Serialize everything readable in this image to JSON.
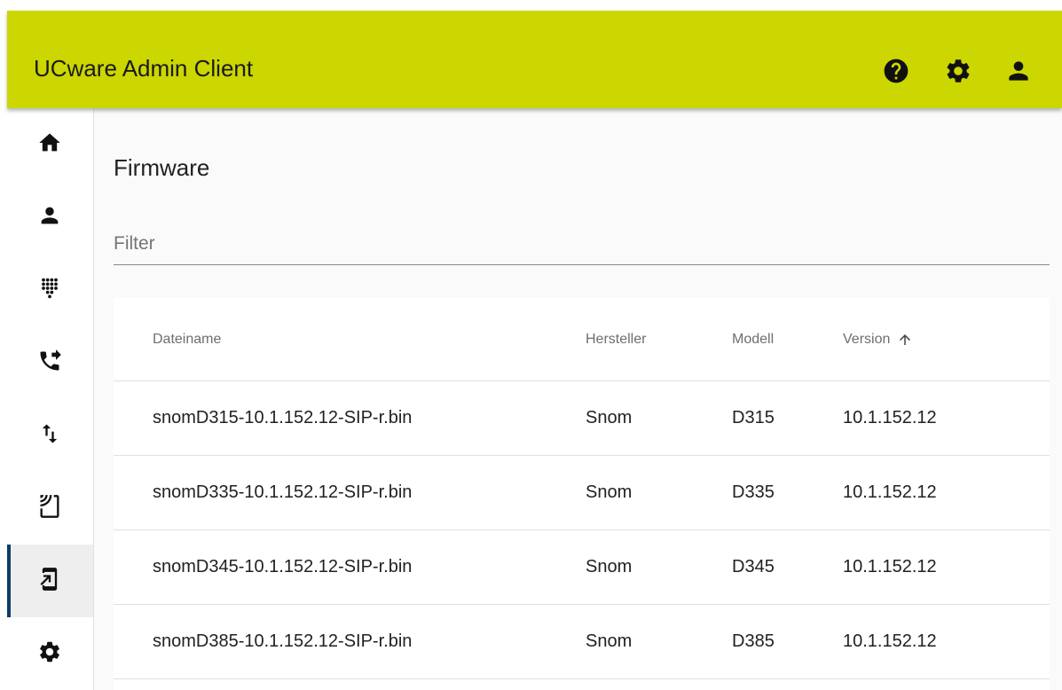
{
  "app": {
    "title": "UCware Admin Client",
    "accent_color": "#ccd600",
    "active_indicator_color": "#0b3d66"
  },
  "toolbar_icons": [
    "help-icon",
    "settings-icon",
    "account-icon"
  ],
  "sidebar": {
    "items": [
      {
        "icon": "home-icon",
        "active": false
      },
      {
        "icon": "user-icon",
        "active": false
      },
      {
        "icon": "dialpad-icon",
        "active": false
      },
      {
        "icon": "phone-forward-icon",
        "active": false
      },
      {
        "icon": "import-export-icon",
        "active": false
      },
      {
        "icon": "cast-icon",
        "active": false
      },
      {
        "icon": "device-settings-icon",
        "active": true
      },
      {
        "icon": "settings-icon",
        "active": false
      }
    ]
  },
  "page": {
    "title": "Firmware",
    "filter_placeholder": "Filter",
    "filter_value": ""
  },
  "table": {
    "columns": [
      "Dateiname",
      "Hersteller",
      "Modell",
      "Version"
    ],
    "sort": {
      "column": "Version",
      "direction": "ascending"
    },
    "rows": [
      {
        "filename": "snomD315-10.1.152.12-SIP-r.bin",
        "vendor": "Snom",
        "model": "D315",
        "version": "10.1.152.12"
      },
      {
        "filename": "snomD335-10.1.152.12-SIP-r.bin",
        "vendor": "Snom",
        "model": "D335",
        "version": "10.1.152.12"
      },
      {
        "filename": "snomD345-10.1.152.12-SIP-r.bin",
        "vendor": "Snom",
        "model": "D345",
        "version": "10.1.152.12"
      },
      {
        "filename": "snomD385-10.1.152.12-SIP-r.bin",
        "vendor": "Snom",
        "model": "D385",
        "version": "10.1.152.12"
      }
    ]
  }
}
